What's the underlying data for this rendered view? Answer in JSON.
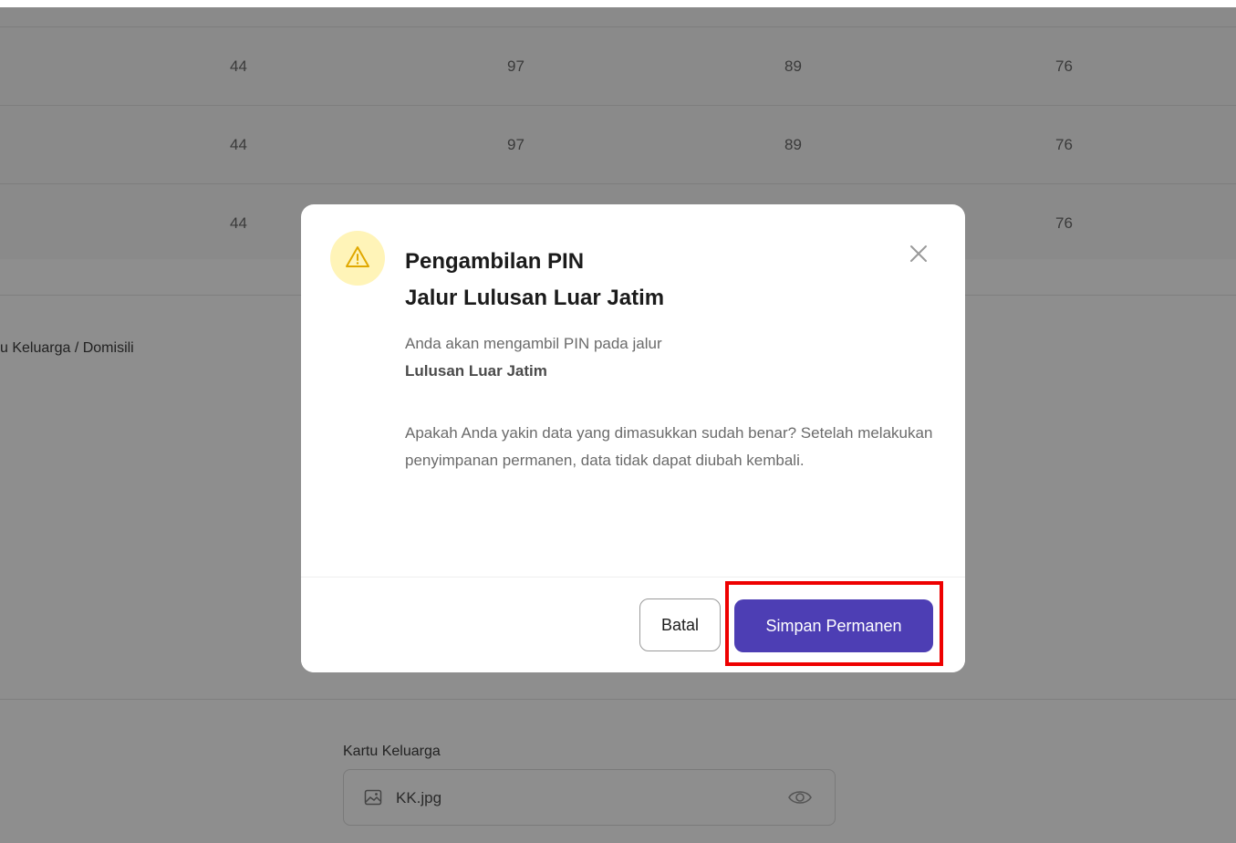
{
  "background": {
    "table_rows": [
      {
        "cells": [
          "44",
          "97",
          "89",
          "76"
        ]
      },
      {
        "cells": [
          "44",
          "97",
          "89",
          "76"
        ]
      },
      {
        "cells": [
          "44",
          "",
          "",
          "76"
        ]
      }
    ],
    "section_label": "u Keluarga / Domisili",
    "kk_label": "Kartu Keluarga",
    "kk_file": "KK.jpg"
  },
  "modal": {
    "title_line1": "Pengambilan PIN",
    "title_line2": "Jalur Lulusan Luar Jatim",
    "message_line1": "Anda akan mengambil PIN pada jalur",
    "message_jalur": "Lulusan Luar Jatim",
    "confirm_text": "Apakah Anda yakin data yang dimasukkan sudah benar? Setelah melakukan penyimpanan permanen, data tidak dapat diubah kembali.",
    "cancel_label": "Batal",
    "save_label": "Simpan Permanen",
    "icons": {
      "warning": "warning-icon",
      "close": "close-icon"
    }
  },
  "colors": {
    "primary": "#4d3eb4",
    "warning_bg": "#fff4b8",
    "warning_stroke": "#e0a800",
    "highlight": "#ee0000",
    "overlay": "#8e8e8e"
  }
}
